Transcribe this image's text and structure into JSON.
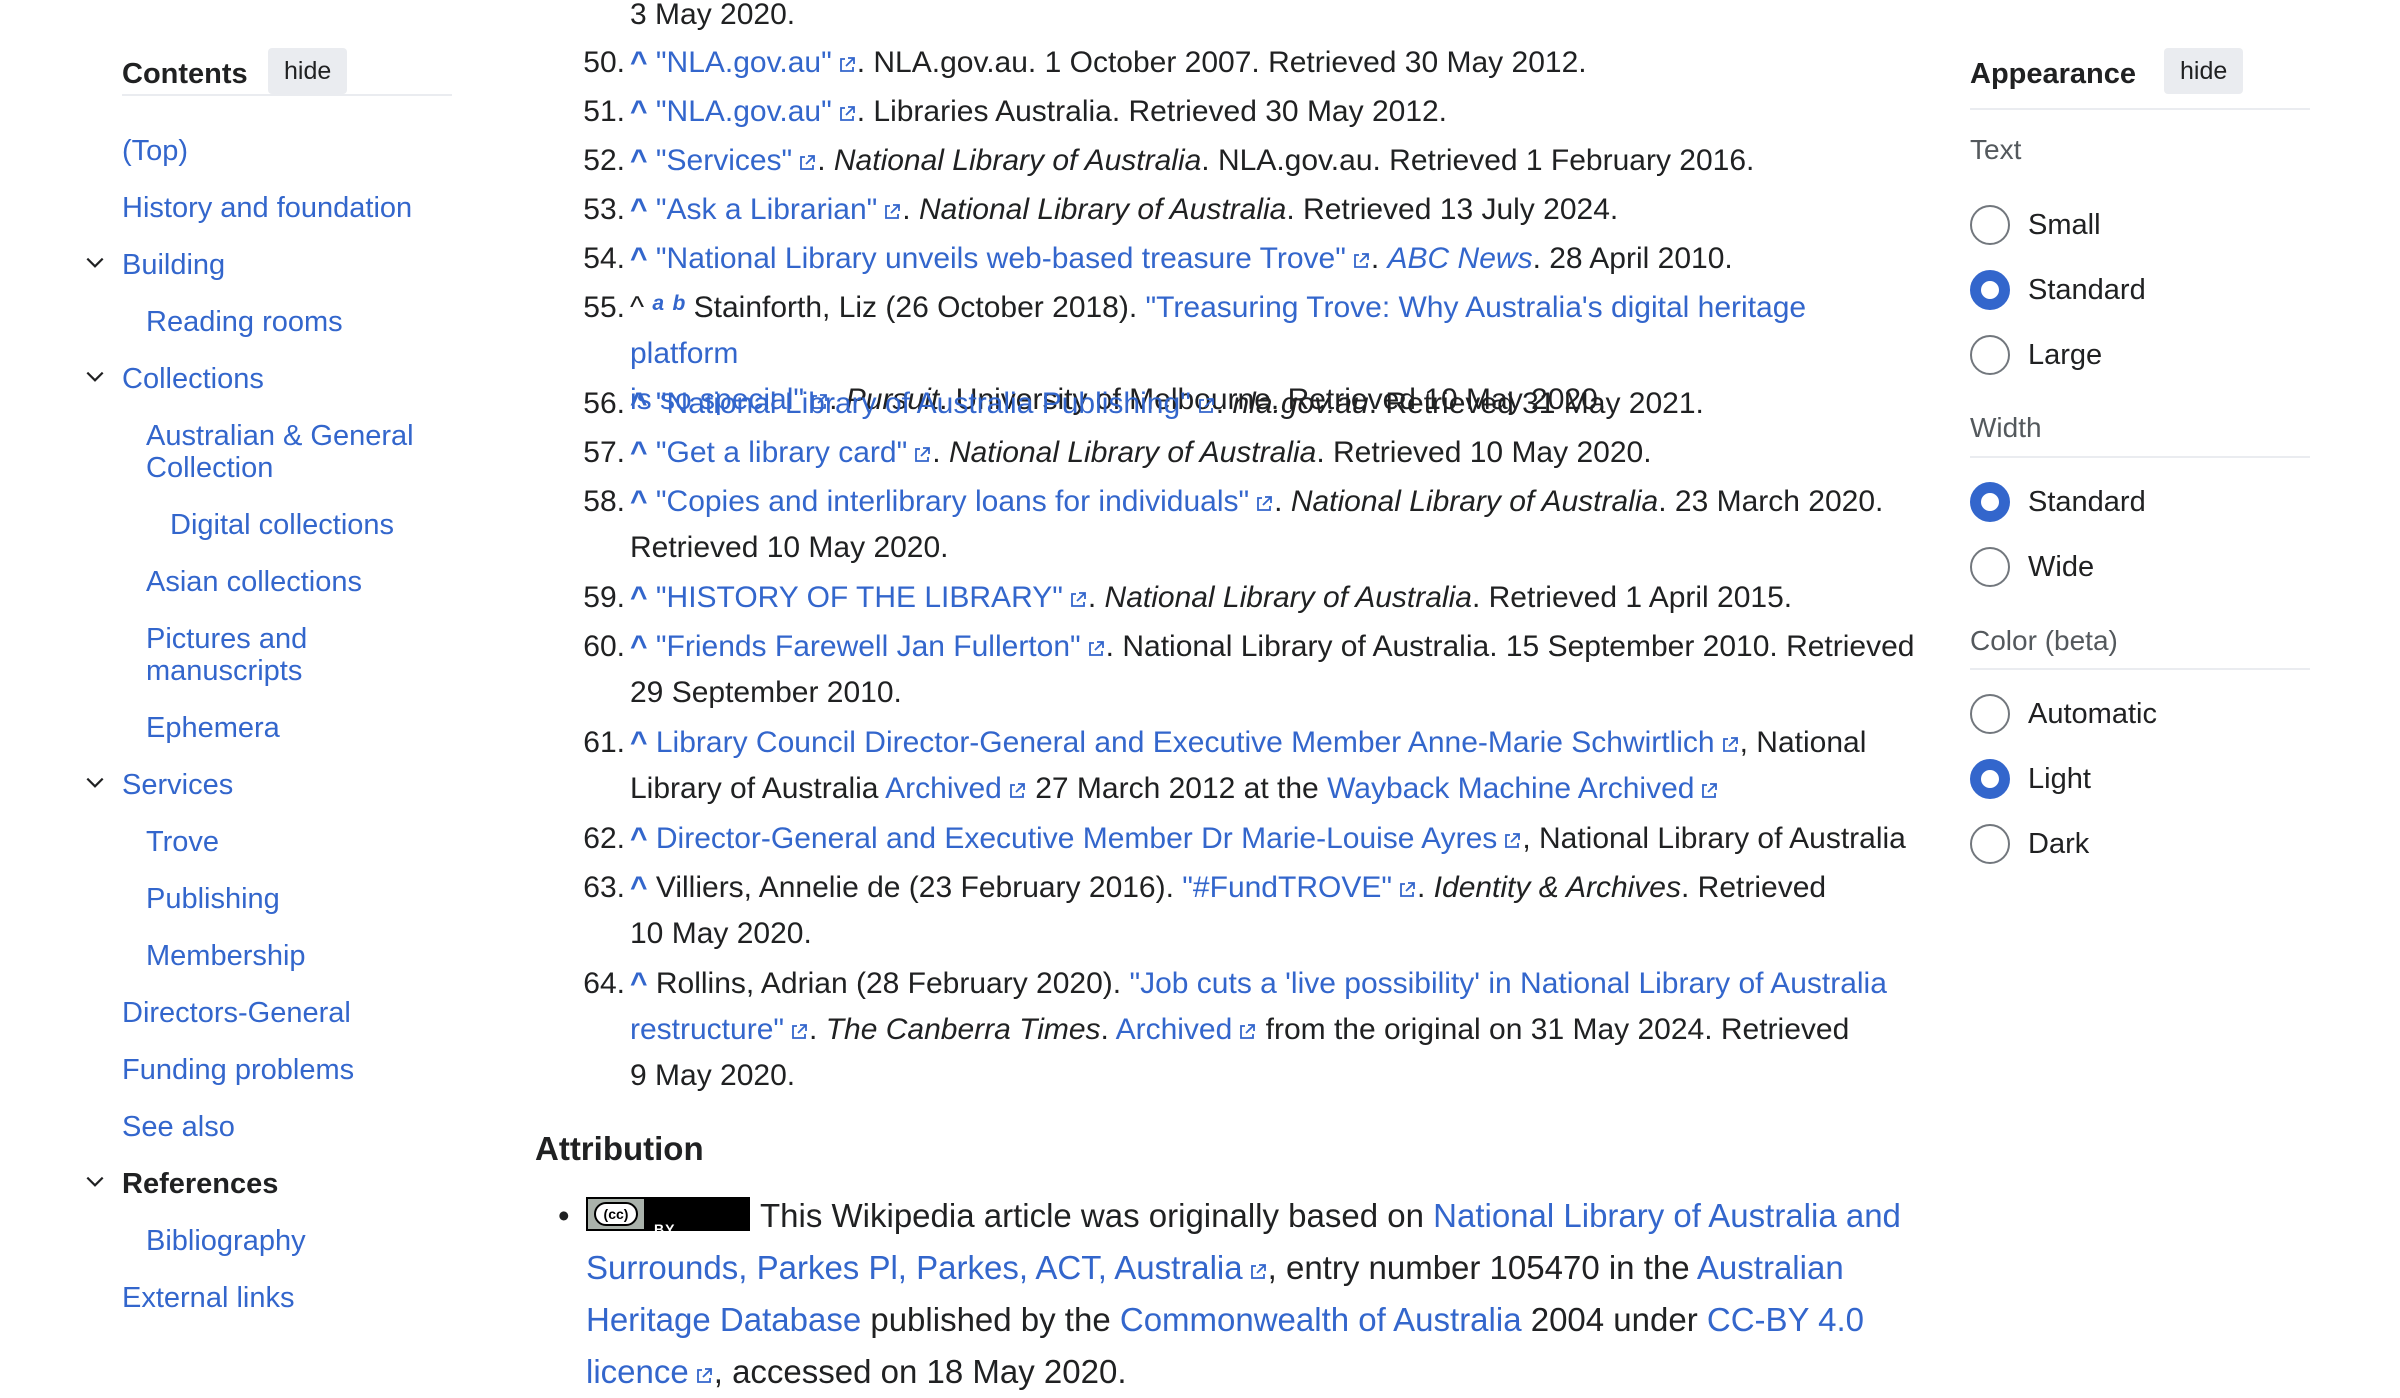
{
  "toc": {
    "title": "Contents",
    "hide_label": "hide",
    "items": [
      {
        "label": "(Top)",
        "level": 1
      },
      {
        "label": "History and foundation",
        "level": 1
      },
      {
        "label": "Building",
        "level": 1,
        "expandable": true
      },
      {
        "label": "Reading rooms",
        "level": 2
      },
      {
        "label": "Collections",
        "level": 1,
        "expandable": true
      },
      {
        "label": "Australian & General Collection",
        "level": 2
      },
      {
        "label": "Digital collections",
        "level": 3
      },
      {
        "label": "Asian collections",
        "level": 2
      },
      {
        "label": "Pictures and manuscripts",
        "level": 2
      },
      {
        "label": "Ephemera",
        "level": 2
      },
      {
        "label": "Services",
        "level": 1,
        "expandable": true
      },
      {
        "label": "Trove",
        "level": 2
      },
      {
        "label": "Publishing",
        "level": 2
      },
      {
        "label": "Membership",
        "level": 2
      },
      {
        "label": "Directors-General",
        "level": 1
      },
      {
        "label": "Funding problems",
        "level": 1
      },
      {
        "label": "See also",
        "level": 1
      },
      {
        "label": "References",
        "level": 1,
        "expandable": true,
        "current": true
      },
      {
        "label": "Bibliography",
        "level": 2
      },
      {
        "label": "External links",
        "level": 2
      }
    ]
  },
  "references": {
    "top_fragment": "3 May 2020.",
    "caret": "^",
    "items": [
      {
        "num": "50.",
        "link": "\"NLA.gov.au\"",
        "rest": ". NLA.gov.au. 1 October 2007. Retrieved 30 May 2012."
      },
      {
        "num": "51.",
        "link": "\"NLA.gov.au\"",
        "rest": ". Libraries Australia. Retrieved 30 May 2012."
      },
      {
        "num": "52.",
        "link": "\"Services\"",
        "work": "National Library of Australia",
        "rest": ". NLA.gov.au. Retrieved 1 February 2016."
      },
      {
        "num": "53.",
        "link": "\"Ask a Librarian\"",
        "work": "National Library of Australia",
        "rest": ". Retrieved 13 July 2024."
      },
      {
        "num": "54.",
        "link": "\"National Library unveils web-based treasure Trove\"",
        "work_link": "ABC News",
        "rest": ". 28 April 2010."
      },
      {
        "num": "55.",
        "sup_a": "a",
        "sup_b": "b",
        "pre": "Stainforth, Liz (26 October 2018). ",
        "link1": "\"Treasuring Trove: Why Australia's digital heritage platform",
        "link2": "is so special\"",
        "work": "Pursuit",
        "rest": ". University of Melbourne. Retrieved 10 May 2020."
      },
      {
        "num": "56.",
        "link": "\"National Library of Australia Publishing\"",
        "work": "nla.gov.au",
        "rest": ". Retrieved 31 May 2021."
      },
      {
        "num": "57.",
        "link": "\"Get a library card\"",
        "work": "National Library of Australia",
        "rest": ". Retrieved 10 May 2020."
      },
      {
        "num": "58.",
        "link": "\"Copies and interlibrary loans for individuals\"",
        "work": "National Library of Australia",
        "rest": ". 23 March 2020.",
        "line2": "Retrieved 10 May 2020."
      },
      {
        "num": "59.",
        "link": "\"HISTORY OF THE LIBRARY\"",
        "work": "National Library of Australia",
        "rest": ". Retrieved 1 April 2015."
      },
      {
        "num": "60.",
        "link": "\"Friends Farewell Jan Fullerton\"",
        "rest": ". National Library of Australia. 15 September 2010. Retrieved",
        "line2": "29 September 2010."
      },
      {
        "num": "61.",
        "link": "Library Council Director-General and Executive Member Anne-Marie Schwirtlich",
        "rest": ", National",
        "line2_pre": "Library of Australia ",
        "archived": "Archived",
        "line2_mid": " 27 March 2012 at the ",
        "wayback": "Wayback Machine Archived"
      },
      {
        "num": "62.",
        "link": "Director-General and Executive Member Dr Marie-Louise Ayres",
        "rest": ", National Library of Australia"
      },
      {
        "num": "63.",
        "pre": "Villiers, Annelie de (23 February 2016). ",
        "link": "\"#FundTROVE\"",
        "work": "Identity & Archives",
        "rest": ". Retrieved",
        "line2": "10 May 2020."
      },
      {
        "num": "64.",
        "pre": "Rollins, Adrian (28 February 2020). ",
        "link1": "\"Job cuts a 'live possibility' in National Library of Australia",
        "link2": "restructure\"",
        "work": "The Canberra Times",
        "archived": "Archived",
        "rest": " from the original on 31 May 2024. Retrieved",
        "line3": "9 May 2020."
      }
    ]
  },
  "attribution": {
    "heading": "Attribution",
    "badge_cc": "(cc)",
    "badge_by": "BY",
    "text1": "This Wikipedia article was originally based on ",
    "link1": "National Library of Australia and Surrounds, Parkes Pl, Parkes, ACT, Australia",
    "text2": ", entry number 105470 in the ",
    "link2": "Australian Heritage Database",
    "text3": " published by the ",
    "link3": "Commonwealth of Australia",
    "text4": " 2004 under ",
    "link4": "CC-BY 4.0 licence",
    "text5": ", accessed on 18 May 2020."
  },
  "appearance": {
    "title": "Appearance",
    "hide_label": "hide",
    "text_label": "Text",
    "text_options": [
      "Small",
      "Standard",
      "Large"
    ],
    "text_selected": "Standard",
    "width_label": "Width",
    "width_options": [
      "Standard",
      "Wide"
    ],
    "width_selected": "Standard",
    "color_label": "Color (beta)",
    "color_options": [
      "Automatic",
      "Light",
      "Dark"
    ],
    "color_selected": "Light"
  },
  "colors": {
    "link": "#3366cc",
    "text": "#202122",
    "muted": "#54595d",
    "border": "#eaecf0"
  }
}
